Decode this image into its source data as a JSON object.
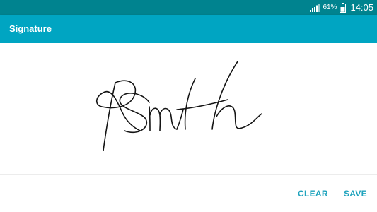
{
  "status_bar": {
    "battery_percent": "61%",
    "time": "14:05",
    "icons": [
      "signal-icon",
      "battery-icon"
    ],
    "background_color": "#00838f"
  },
  "app_bar": {
    "title": "Signature",
    "background_color": "#00a5c2"
  },
  "actions": {
    "clear_label": "CLEAR",
    "save_label": "SAVE",
    "accent_color": "#1fa3bd"
  }
}
